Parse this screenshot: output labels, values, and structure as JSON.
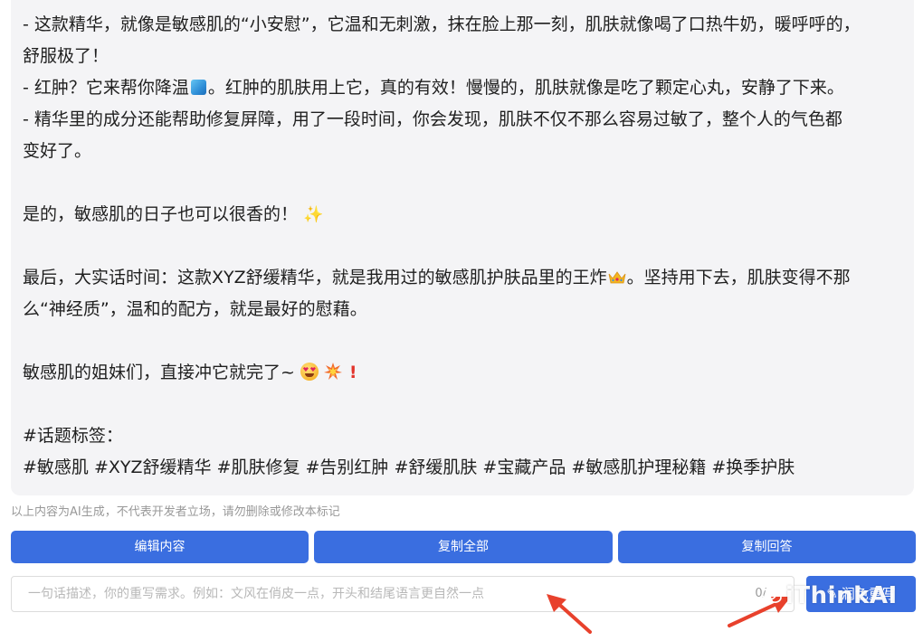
{
  "content": {
    "lines": [
      "- 这款精华，就像是敏感肌的“小安慰”，它温和无刺激，抹在脸上那一刻，肌肤就像喝了口热牛奶，暖呼呼的，",
      "舒服极了！",
      "- 红肿？它来帮你降温",
      "。红肿的肌肤用上它，真的有效！慢慢的，肌肤就像是吃了颗定心丸，安静了下来。",
      "- 精华里的成分还能帮助修复屏障，用了一段时间，你会发现，肌肤不仅不那么容易过敏了，整个人的气色都",
      "变好了。",
      "是的，敏感肌的日子也可以很香的！",
      "最后，大实话时间：这款XYZ舒缓精华，就是我用过的敏感肌护肤品里的王炸",
      "。坚持用下去，肌肤变得不那",
      "么“神经质”，温和的配方，就是最好的慰藉。",
      "敏感肌的姐妹们，直接冲它就完了~",
      "#话题标签：",
      "#敏感肌 #XYZ舒缓精华 #肌肤修复 #告别红肿 #舒缓肌肤 #宝藏产品 #敏感肌护理秘籍 #换季护肤"
    ]
  },
  "disclaimer": "以上内容为AI生成，不代表开发者立场，请勿删除或修改本标记",
  "buttons": {
    "edit": "编辑内容",
    "copy_all": "复制全部",
    "copy_answer": "复制回答"
  },
  "rewrite": {
    "placeholder": "一句话描述，你的重写需求。例如：文风在俏皮一点，开头和结尾语言更自然一点",
    "counter": "0/",
    "button_label": "润色重写"
  },
  "watermark": "iThinkAI",
  "colors": {
    "primary": "#3a6ee0",
    "card_bg": "#f4f4f6",
    "arrow": "#e8412c"
  }
}
